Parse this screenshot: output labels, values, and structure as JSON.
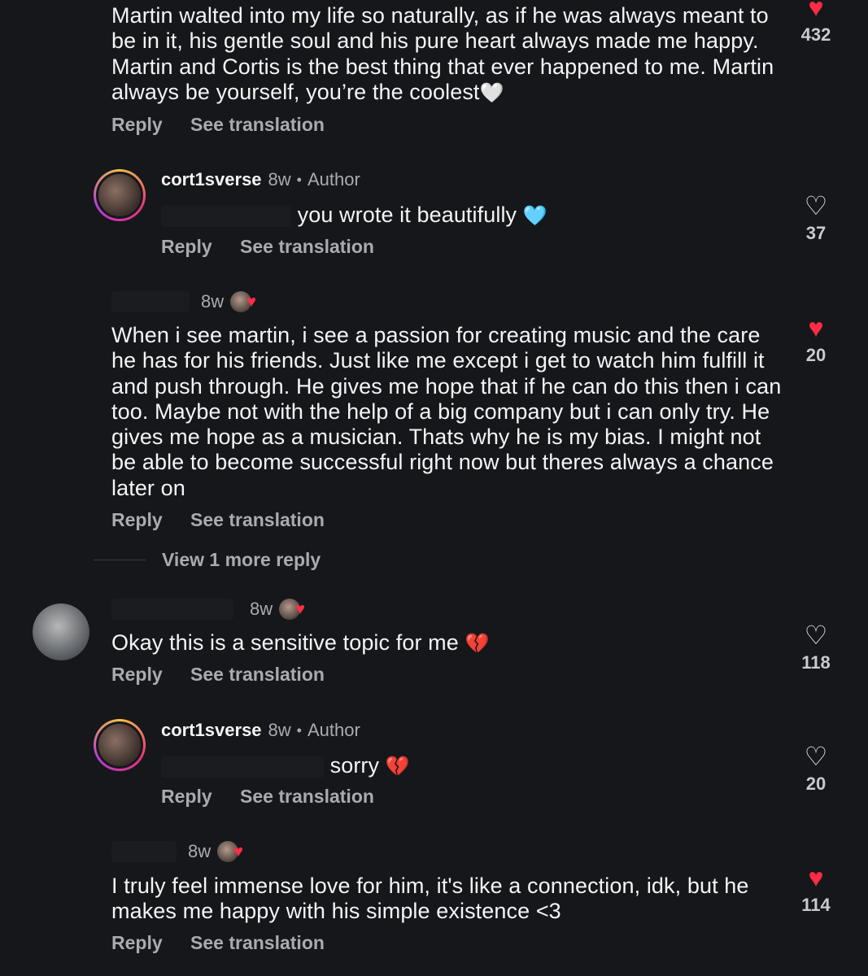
{
  "comments": [
    {
      "text": "Martin walted into my life so naturally, as if he was always meant to be in it, his gentle soul and his pure heart always made me happy. Martin and Cortis is the best thing that ever happened to me. Martin always be yourself, you’re the coolest",
      "emoji": "🤍",
      "reply": "Reply",
      "see_translation": "See translation",
      "likes": "432",
      "liked": true
    },
    {
      "username": "cort1sverse",
      "time": "8w",
      "author_label": "Author",
      "text": "you wrote it beautifully",
      "emoji": "🩵",
      "reply": "Reply",
      "see_translation": "See translation",
      "likes": "37",
      "liked": false
    },
    {
      "time": "8w",
      "text": "When i see martin, i see a passion for creating music and the care he has for his friends. Just like me except i get to watch him fulfill it and push through. He gives me hope that if he can do this then i can too. Maybe not with the help of a big company but i can only try. He gives me hope as a musician. Thats why he is my bias. I might not be able to become successful right now but theres always a chance later on",
      "reply": "Reply",
      "see_translation": "See translation",
      "likes": "20",
      "liked": true,
      "view_more": "View 1 more reply"
    },
    {
      "time": "8w",
      "text": "Okay this is a sensitive topic for me",
      "emoji": "💔",
      "reply": "Reply",
      "see_translation": "See translation",
      "likes": "118",
      "liked": false
    },
    {
      "username": "cort1sverse",
      "time": "8w",
      "author_label": "Author",
      "text": "sorry",
      "emoji": "💔",
      "reply": "Reply",
      "see_translation": "See translation",
      "likes": "20",
      "liked": false
    },
    {
      "time": "8w",
      "text": "I truly feel immense love for him, it's like a connection, idk, but he makes me happy with his simple existence <3",
      "reply": "Reply",
      "see_translation": "See translation",
      "likes": "114",
      "liked": true
    }
  ],
  "icons": {
    "heart_filled": "heart-filled-icon",
    "heart_outline": "heart-outline-icon"
  },
  "colors": {
    "background": "#16171b",
    "like_red": "#ff2d43",
    "secondary_text": "#a9abb0"
  }
}
